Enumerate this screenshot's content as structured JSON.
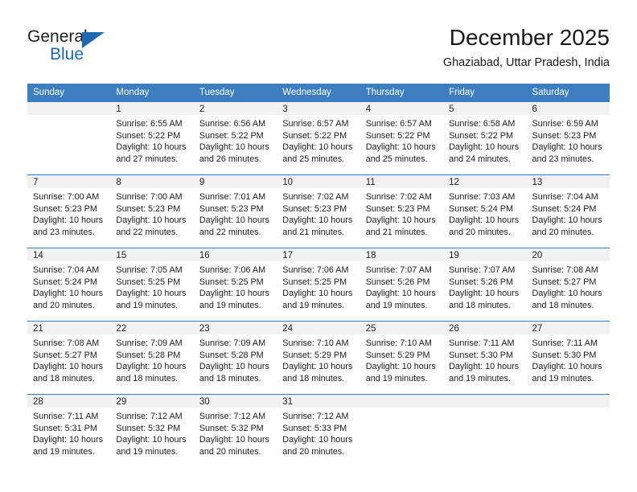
{
  "brand": {
    "name_dark": "General",
    "name_blue": "Blue",
    "accent_color": "#1b6ab3"
  },
  "header": {
    "title": "December 2025",
    "subtitle": "Ghaziabad, Uttar Pradesh, India"
  },
  "theme": {
    "header_row_bg": "#3c7ebf",
    "daynum_band_bg": "#f2f2f2",
    "grid_line": "#3c7ebf",
    "text": "#202020"
  },
  "weekday_headers": [
    "Sunday",
    "Monday",
    "Tuesday",
    "Wednesday",
    "Thursday",
    "Friday",
    "Saturday"
  ],
  "labels": {
    "sunrise_prefix": "Sunrise:",
    "sunset_prefix": "Sunset:",
    "daylight_prefix": "Daylight:"
  },
  "weeks": [
    [
      {
        "day": "",
        "sunrise": "",
        "sunset": "",
        "daylight": "",
        "empty": true
      },
      {
        "day": "1",
        "sunrise": "Sunrise: 6:55 AM",
        "sunset": "Sunset: 5:22 PM",
        "daylight": "Daylight: 10 hours and 27 minutes.",
        "empty": false
      },
      {
        "day": "2",
        "sunrise": "Sunrise: 6:56 AM",
        "sunset": "Sunset: 5:22 PM",
        "daylight": "Daylight: 10 hours and 26 minutes.",
        "empty": false
      },
      {
        "day": "3",
        "sunrise": "Sunrise: 6:57 AM",
        "sunset": "Sunset: 5:22 PM",
        "daylight": "Daylight: 10 hours and 25 minutes.",
        "empty": false
      },
      {
        "day": "4",
        "sunrise": "Sunrise: 6:57 AM",
        "sunset": "Sunset: 5:22 PM",
        "daylight": "Daylight: 10 hours and 25 minutes.",
        "empty": false
      },
      {
        "day": "5",
        "sunrise": "Sunrise: 6:58 AM",
        "sunset": "Sunset: 5:22 PM",
        "daylight": "Daylight: 10 hours and 24 minutes.",
        "empty": false
      },
      {
        "day": "6",
        "sunrise": "Sunrise: 6:59 AM",
        "sunset": "Sunset: 5:23 PM",
        "daylight": "Daylight: 10 hours and 23 minutes.",
        "empty": false
      }
    ],
    [
      {
        "day": "7",
        "sunrise": "Sunrise: 7:00 AM",
        "sunset": "Sunset: 5:23 PM",
        "daylight": "Daylight: 10 hours and 23 minutes.",
        "empty": false
      },
      {
        "day": "8",
        "sunrise": "Sunrise: 7:00 AM",
        "sunset": "Sunset: 5:23 PM",
        "daylight": "Daylight: 10 hours and 22 minutes.",
        "empty": false
      },
      {
        "day": "9",
        "sunrise": "Sunrise: 7:01 AM",
        "sunset": "Sunset: 5:23 PM",
        "daylight": "Daylight: 10 hours and 22 minutes.",
        "empty": false
      },
      {
        "day": "10",
        "sunrise": "Sunrise: 7:02 AM",
        "sunset": "Sunset: 5:23 PM",
        "daylight": "Daylight: 10 hours and 21 minutes.",
        "empty": false
      },
      {
        "day": "11",
        "sunrise": "Sunrise: 7:02 AM",
        "sunset": "Sunset: 5:23 PM",
        "daylight": "Daylight: 10 hours and 21 minutes.",
        "empty": false
      },
      {
        "day": "12",
        "sunrise": "Sunrise: 7:03 AM",
        "sunset": "Sunset: 5:24 PM",
        "daylight": "Daylight: 10 hours and 20 minutes.",
        "empty": false
      },
      {
        "day": "13",
        "sunrise": "Sunrise: 7:04 AM",
        "sunset": "Sunset: 5:24 PM",
        "daylight": "Daylight: 10 hours and 20 minutes.",
        "empty": false
      }
    ],
    [
      {
        "day": "14",
        "sunrise": "Sunrise: 7:04 AM",
        "sunset": "Sunset: 5:24 PM",
        "daylight": "Daylight: 10 hours and 20 minutes.",
        "empty": false
      },
      {
        "day": "15",
        "sunrise": "Sunrise: 7:05 AM",
        "sunset": "Sunset: 5:25 PM",
        "daylight": "Daylight: 10 hours and 19 minutes.",
        "empty": false
      },
      {
        "day": "16",
        "sunrise": "Sunrise: 7:06 AM",
        "sunset": "Sunset: 5:25 PM",
        "daylight": "Daylight: 10 hours and 19 minutes.",
        "empty": false
      },
      {
        "day": "17",
        "sunrise": "Sunrise: 7:06 AM",
        "sunset": "Sunset: 5:25 PM",
        "daylight": "Daylight: 10 hours and 19 minutes.",
        "empty": false
      },
      {
        "day": "18",
        "sunrise": "Sunrise: 7:07 AM",
        "sunset": "Sunset: 5:26 PM",
        "daylight": "Daylight: 10 hours and 19 minutes.",
        "empty": false
      },
      {
        "day": "19",
        "sunrise": "Sunrise: 7:07 AM",
        "sunset": "Sunset: 5:26 PM",
        "daylight": "Daylight: 10 hours and 18 minutes.",
        "empty": false
      },
      {
        "day": "20",
        "sunrise": "Sunrise: 7:08 AM",
        "sunset": "Sunset: 5:27 PM",
        "daylight": "Daylight: 10 hours and 18 minutes.",
        "empty": false
      }
    ],
    [
      {
        "day": "21",
        "sunrise": "Sunrise: 7:08 AM",
        "sunset": "Sunset: 5:27 PM",
        "daylight": "Daylight: 10 hours and 18 minutes.",
        "empty": false
      },
      {
        "day": "22",
        "sunrise": "Sunrise: 7:09 AM",
        "sunset": "Sunset: 5:28 PM",
        "daylight": "Daylight: 10 hours and 18 minutes.",
        "empty": false
      },
      {
        "day": "23",
        "sunrise": "Sunrise: 7:09 AM",
        "sunset": "Sunset: 5:28 PM",
        "daylight": "Daylight: 10 hours and 18 minutes.",
        "empty": false
      },
      {
        "day": "24",
        "sunrise": "Sunrise: 7:10 AM",
        "sunset": "Sunset: 5:29 PM",
        "daylight": "Daylight: 10 hours and 18 minutes.",
        "empty": false
      },
      {
        "day": "25",
        "sunrise": "Sunrise: 7:10 AM",
        "sunset": "Sunset: 5:29 PM",
        "daylight": "Daylight: 10 hours and 19 minutes.",
        "empty": false
      },
      {
        "day": "26",
        "sunrise": "Sunrise: 7:11 AM",
        "sunset": "Sunset: 5:30 PM",
        "daylight": "Daylight: 10 hours and 19 minutes.",
        "empty": false
      },
      {
        "day": "27",
        "sunrise": "Sunrise: 7:11 AM",
        "sunset": "Sunset: 5:30 PM",
        "daylight": "Daylight: 10 hours and 19 minutes.",
        "empty": false
      }
    ],
    [
      {
        "day": "28",
        "sunrise": "Sunrise: 7:11 AM",
        "sunset": "Sunset: 5:31 PM",
        "daylight": "Daylight: 10 hours and 19 minutes.",
        "empty": false
      },
      {
        "day": "29",
        "sunrise": "Sunrise: 7:12 AM",
        "sunset": "Sunset: 5:32 PM",
        "daylight": "Daylight: 10 hours and 19 minutes.",
        "empty": false
      },
      {
        "day": "30",
        "sunrise": "Sunrise: 7:12 AM",
        "sunset": "Sunset: 5:32 PM",
        "daylight": "Daylight: 10 hours and 20 minutes.",
        "empty": false
      },
      {
        "day": "31",
        "sunrise": "Sunrise: 7:12 AM",
        "sunset": "Sunset: 5:33 PM",
        "daylight": "Daylight: 10 hours and 20 minutes.",
        "empty": false
      },
      {
        "day": "",
        "sunrise": "",
        "sunset": "",
        "daylight": "",
        "empty": true
      },
      {
        "day": "",
        "sunrise": "",
        "sunset": "",
        "daylight": "",
        "empty": true
      },
      {
        "day": "",
        "sunrise": "",
        "sunset": "",
        "daylight": "",
        "empty": true
      }
    ]
  ]
}
